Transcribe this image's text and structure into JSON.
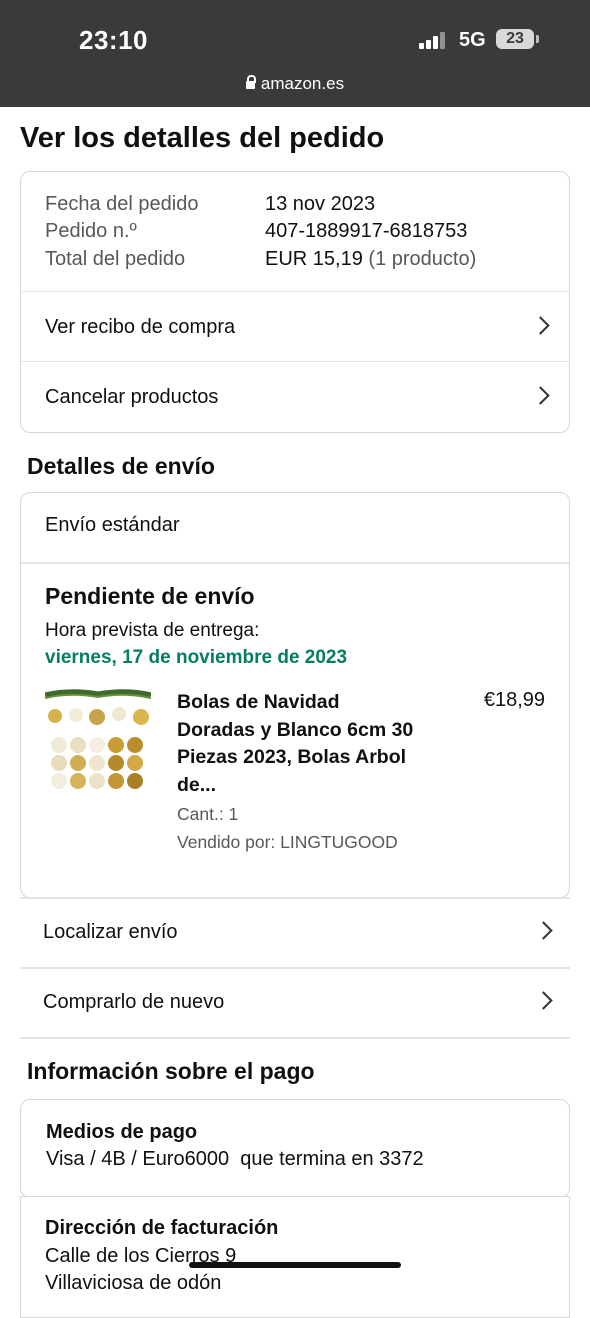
{
  "status_bar": {
    "time": "23:10",
    "network": "5G",
    "battery": "23"
  },
  "browser": {
    "url": "amazon.es"
  },
  "page": {
    "title": "Ver los detalles del pedido"
  },
  "order_summary": {
    "date_label": "Fecha del pedido",
    "date_value": "13 nov 2023",
    "order_label": "Pedido n.º",
    "order_value": "407-1889917-6818753",
    "total_label": "Total del pedido",
    "total_value": "EUR 15,19",
    "total_count": "(1 producto)",
    "receipt_label": "Ver recibo de compra",
    "cancel_label": "Cancelar productos"
  },
  "shipping": {
    "heading": "Detalles de envío",
    "method": "Envío estándar",
    "status": "Pendiente de envío",
    "eta_label": "Hora prevista de entrega:",
    "eta_date": "viernes, 17 de noviembre de 2023",
    "item": {
      "title": "Bolas de Navidad Doradas y Blanco 6cm 30 Piezas 2023, Bolas Arbol de...",
      "price": "€18,99",
      "quantity": "Cant.: 1",
      "seller": "Vendido por: LINGTUGOOD"
    },
    "track_label": "Localizar envío",
    "buy_again_label": "Comprarlo de nuevo"
  },
  "payment": {
    "heading": "Información sobre el pago",
    "methods_label": "Medios de pago",
    "methods_value": "Visa / 4B / Euro6000  que termina en 3372",
    "billing_label": "Dirección de facturación",
    "billing_line1": "Calle de los Cierros 9",
    "billing_line2": "Villaviciosa de odón"
  },
  "colors": {
    "eta_green": "#067d62",
    "status_bar": "#3a3a3c"
  },
  "icons": {
    "lock": "lock-icon",
    "chevron": "chevron-right-icon",
    "signal": "signal-icon"
  }
}
